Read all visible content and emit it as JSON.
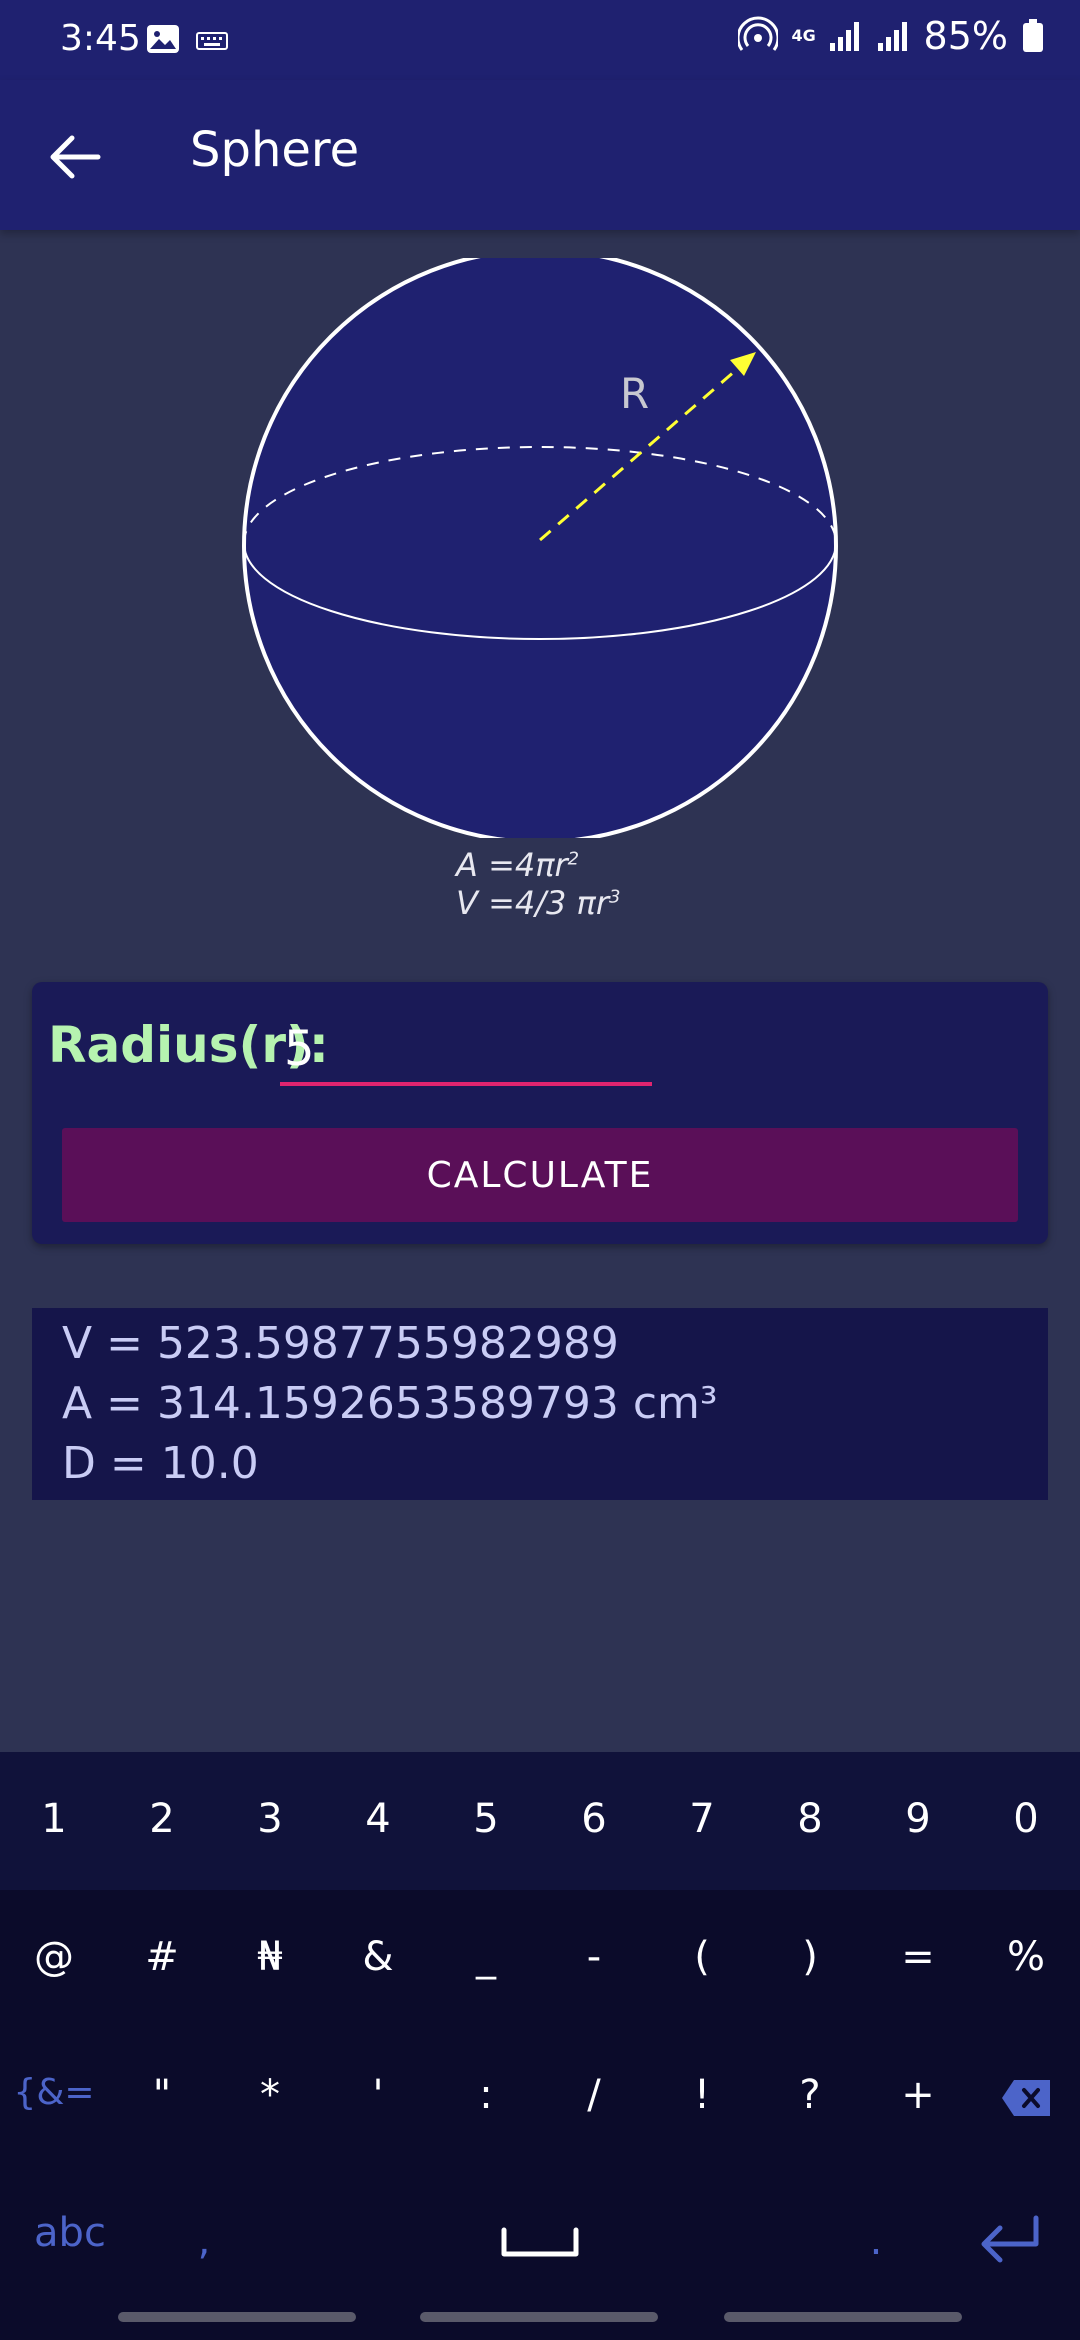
{
  "status": {
    "time": "3:45",
    "battery": "85%",
    "net": "4G"
  },
  "appbar": {
    "title": "Sphere"
  },
  "formula": {
    "area_prefix": "A =4πr",
    "area_exp": "2",
    "volume_prefix": "V =4/3 πr",
    "volume_exp": "3"
  },
  "diagram": {
    "radius_label": "R"
  },
  "input": {
    "label": "Radius(r):",
    "value": "5"
  },
  "button": {
    "label": "CALCULATE"
  },
  "results": {
    "volume": "V = 523.5987755982989",
    "area": "A = 314.1592653589793  cm³",
    "diameter": "D = 10.0"
  },
  "keyboard": {
    "row1": [
      "1",
      "2",
      "3",
      "4",
      "5",
      "6",
      "7",
      "8",
      "9",
      "0"
    ],
    "row2": [
      "@",
      "#",
      "₦",
      "&",
      "_",
      "-",
      "(",
      ")",
      "=",
      "%"
    ],
    "row3": [
      "{&=",
      "\"",
      "*",
      "'",
      ":",
      "/",
      "!",
      "?",
      "+"
    ],
    "row4": {
      "abc": "abc",
      "comma": ",",
      "period": "."
    }
  },
  "colors": {
    "appbar": "#1f2170",
    "background": "#2e3353",
    "accent": "#e0246f",
    "button": "#5a0f58",
    "label": "#b6f3b0"
  }
}
